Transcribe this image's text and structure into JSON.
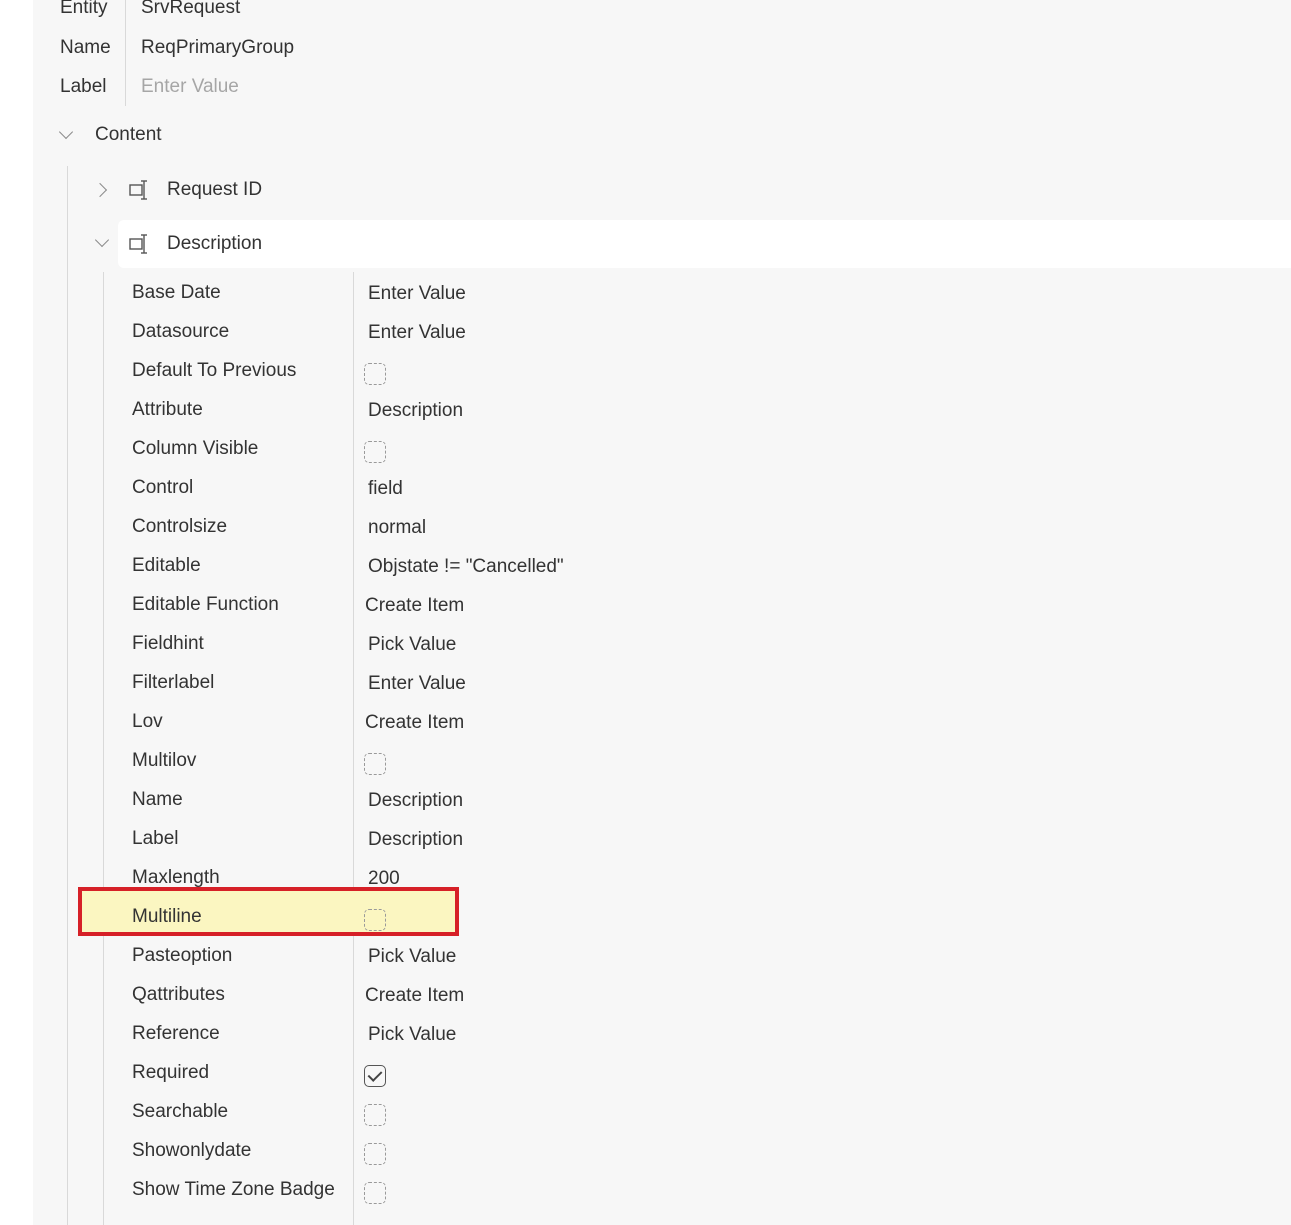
{
  "header": {
    "entity_label": "Entity",
    "entity_value": "SrvRequest",
    "name_label": "Name",
    "name_value": "ReqPrimaryGroup",
    "label_label": "Label",
    "label_placeholder": "Enter Value"
  },
  "content": {
    "title": "Content",
    "nodes": [
      {
        "label": "Request ID",
        "icon": "field-icon",
        "expanded": false
      },
      {
        "label": "Description",
        "icon": "field-icon",
        "expanded": true
      }
    ]
  },
  "properties": [
    {
      "name": "Base Date",
      "type": "placeholder",
      "value": "Enter Value"
    },
    {
      "name": "Datasource",
      "type": "placeholder",
      "value": "Enter Value"
    },
    {
      "name": "Default To Previous",
      "type": "checkbox",
      "checked": false
    },
    {
      "name": "Attribute",
      "type": "text",
      "value": "Description"
    },
    {
      "name": "Column Visible",
      "type": "checkbox",
      "checked": false
    },
    {
      "name": "Control",
      "type": "text",
      "value": "field"
    },
    {
      "name": "Controlsize",
      "type": "text",
      "value": "normal"
    },
    {
      "name": "Editable",
      "type": "text",
      "value": "Objstate != \"Cancelled\""
    },
    {
      "name": "Editable Function",
      "type": "placeholder",
      "value": "Create Item"
    },
    {
      "name": "Fieldhint",
      "type": "placeholder",
      "value": "Pick Value"
    },
    {
      "name": "Filterlabel",
      "type": "placeholder",
      "value": "Enter Value"
    },
    {
      "name": "Lov",
      "type": "placeholder",
      "value": "Create Item"
    },
    {
      "name": "Multilov",
      "type": "checkbox",
      "checked": false
    },
    {
      "name": "Name",
      "type": "text",
      "value": "Description"
    },
    {
      "name": "Label",
      "type": "text",
      "value": "Description"
    },
    {
      "name": "Maxlength",
      "type": "text",
      "value": "200"
    },
    {
      "name": "Multiline",
      "type": "checkbox",
      "checked": false,
      "highlighted": true
    },
    {
      "name": "Pasteoption",
      "type": "placeholder",
      "value": "Pick Value"
    },
    {
      "name": "Qattributes",
      "type": "placeholder",
      "value": "Create Item"
    },
    {
      "name": "Reference",
      "type": "placeholder",
      "value": "Pick Value"
    },
    {
      "name": "Required",
      "type": "checkbox",
      "checked": true
    },
    {
      "name": "Searchable",
      "type": "checkbox",
      "checked": false
    },
    {
      "name": "Showonlydate",
      "type": "checkbox",
      "checked": false
    },
    {
      "name": "Show Time Zone Badge",
      "type": "checkbox",
      "checked": false
    }
  ],
  "colors": {
    "highlight_fill": "#fbf6c1",
    "highlight_border": "#d62027"
  }
}
